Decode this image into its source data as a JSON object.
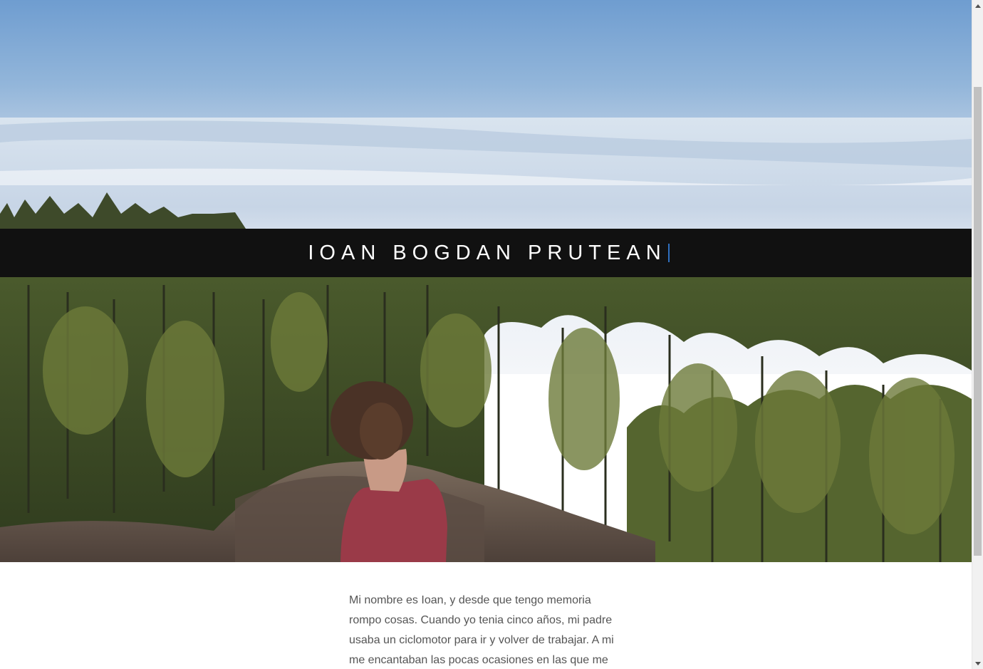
{
  "header": {
    "title": "IOAN BOGDAN PRUTEAN",
    "caret_color": "#2f6fbf",
    "band_color": "#111111"
  },
  "hero": {
    "image": "hero-photo-landscape",
    "description_icon": "photo-icon"
  },
  "bio": {
    "text": "Mi nombre es Ioan, y desde que tengo memoria rompo cosas. Cuando yo tenia cinco años, mi padre usaba un ciclomotor para ir y volver de trabajar. A mi me encantaban las pocas ocasiones en las que me"
  },
  "scrollbar": {
    "position": 0.13
  }
}
